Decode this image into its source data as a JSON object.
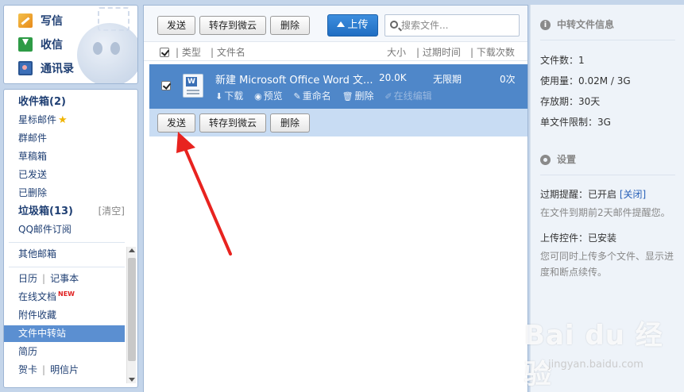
{
  "quick_links": [
    {
      "label": "写信",
      "icon": "compose-icon"
    },
    {
      "label": "收信",
      "icon": "inbox-download-icon"
    },
    {
      "label": "通讯录",
      "icon": "contacts-icon"
    }
  ],
  "folders": {
    "inbox": "收件箱(2)",
    "starred": "星标邮件",
    "group": "群邮件",
    "drafts": "草稿箱",
    "sent": "已发送",
    "deleted": "已删除",
    "spam": "垃圾箱(13)",
    "spam_clear": "[清空]",
    "subscription": "QQ邮件订阅",
    "other_mailbox": "其他邮箱",
    "calendar": "日历",
    "notepad": "记事本",
    "online_docs": "在线文档",
    "online_docs_badge": "NEW",
    "attachments": "附件收藏",
    "file_transfer": "文件中转站",
    "resume": "简历",
    "greeting_card": "贺卡",
    "postcard": "明信片",
    "separator": "|"
  },
  "toolbar": {
    "send": "发送",
    "save_to_weiyun": "转存到微云",
    "delete": "删除",
    "upload": "上传",
    "search_placeholder": "搜索文件..."
  },
  "columns": {
    "type": "| 类型",
    "filename": "| 文件名",
    "size": "大小",
    "expire": "| 过期时间",
    "downloads": "| 下载次数"
  },
  "files": [
    {
      "name": "新建 Microsoft Office Word 文...",
      "size": "20.0K",
      "expire": "无限期",
      "downloads": "0次",
      "actions": [
        "下载",
        "预览",
        "重命名",
        "删除",
        "在线编辑"
      ]
    }
  ],
  "info": {
    "title": "中转文件信息",
    "file_count": "文件数：1",
    "usage": "使用量：0.02M / 3G",
    "retention": "存放期：30天",
    "single_limit": "单文件限制：3G"
  },
  "settings": {
    "title": "设置",
    "expire_reminder": "过期提醒：已开启",
    "close_link": "[关闭]",
    "expire_note": "在文件到期前2天邮件提醒您。",
    "upload_control": "上传控件：已安装",
    "upload_note": "您可同时上传多个文件、显示进度和断点续传。"
  },
  "watermark": {
    "brand": "Bai du 经验",
    "url": "jingyan.baidu.com"
  },
  "colors": {
    "selected_row": "#4f87c9",
    "active_nav": "#5b8fd1",
    "upload_button": "#1f6dc2",
    "annotation_arrow": "#e8231f"
  }
}
